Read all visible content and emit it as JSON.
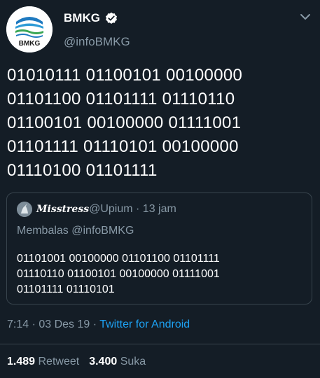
{
  "author": {
    "display_name": "BMKG",
    "handle": "@infoBMKG",
    "avatar_text": "BMKG",
    "verified": true
  },
  "tweet_text": "01010111 01100101 00100000\n01101100 01101111 01110110\n01100101 00100000 01111001\n01101111 01110101 00100000\n01110100 01101111",
  "quoted_tweet": {
    "name": "Misstress",
    "handle": "@Upium",
    "separator": " · ",
    "time": "13 jam",
    "reply_to": "Membalas @infoBMKG",
    "text": "01101001 00100000 01101100 01101111\n01110110 01100101 00100000 01111001\n01101111 01110101"
  },
  "meta": {
    "time": "7:14",
    "separator": " · ",
    "date": "03 Des 19",
    "source": "Twitter for Android"
  },
  "stats": {
    "retweets": "1.489",
    "retweets_label": "Retweet",
    "likes": "3.400",
    "likes_label": "Suka"
  },
  "colors": {
    "background": "#141d26",
    "secondary_text": "#8899a6",
    "link": "#1da1f2",
    "border": "#38444d"
  }
}
